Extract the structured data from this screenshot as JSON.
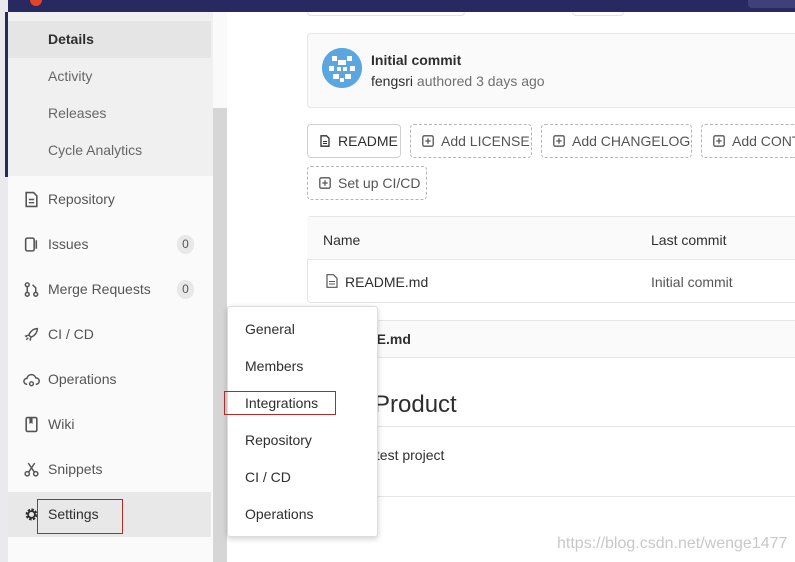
{
  "sidebar": {
    "submenu": [
      {
        "label": "Details",
        "active": true
      },
      {
        "label": "Activity"
      },
      {
        "label": "Releases"
      },
      {
        "label": "Cycle Analytics"
      }
    ],
    "items": [
      {
        "label": "Repository",
        "icon": "document-icon"
      },
      {
        "label": "Issues",
        "icon": "issues-icon",
        "count": "0"
      },
      {
        "label": "Merge Requests",
        "icon": "merge-request-icon",
        "count": "0"
      },
      {
        "label": "CI / CD",
        "icon": "rocket-icon"
      },
      {
        "label": "Operations",
        "icon": "cloud-gear-icon"
      },
      {
        "label": "Wiki",
        "icon": "book-icon"
      },
      {
        "label": "Snippets",
        "icon": "scissors-icon"
      },
      {
        "label": "Settings",
        "icon": "gear-icon",
        "active": true
      }
    ]
  },
  "commit": {
    "title": "Initial commit",
    "author": "fengsri",
    "meta": "authored 3 days ago"
  },
  "buttons": {
    "readme": "README",
    "add_license": "Add LICENSE",
    "add_changelog": "Add CHANGELOG",
    "add_contributing": "Add CONT",
    "setup_cicd": "Set up CI/CD"
  },
  "file_table": {
    "headers": {
      "name": "Name",
      "last_commit": "Last commit"
    },
    "rows": [
      {
        "name": "README.md",
        "last_commit": "Initial commit"
      }
    ]
  },
  "readme": {
    "header": "ME.md",
    "heading": "Product",
    "paragraph": "s test project"
  },
  "settings_flyout": {
    "items": [
      "General",
      "Members",
      "Integrations",
      "Repository",
      "CI / CD",
      "Operations"
    ],
    "highlighted": "Integrations"
  },
  "watermark": "https://blog.csdn.net/wenge1477",
  "colors": {
    "navbar": "#292961",
    "highlight_border": "#b02a2a",
    "avatar": "#5aa6e0"
  }
}
